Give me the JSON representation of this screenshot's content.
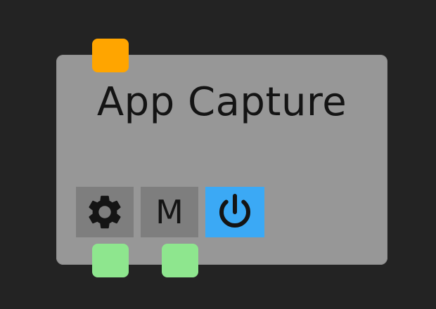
{
  "node": {
    "title": "App Capture",
    "mode_label": "M",
    "icons": {
      "settings": "gear-icon",
      "power": "power-icon"
    }
  },
  "colors": {
    "input_port": "#FFA500",
    "output_port": "#8EE68E",
    "power_active": "#3BA9F5"
  }
}
